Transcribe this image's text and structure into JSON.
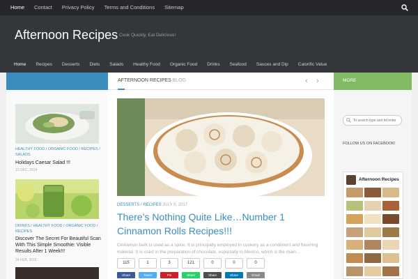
{
  "topbar": {
    "links": [
      "Home",
      "Contact",
      "Privacy Policy",
      "Terms and Conditions",
      "Sitemap"
    ],
    "active_index": 0
  },
  "header": {
    "site_title": "Afternoon Recipes",
    "tagline": "Cook Quickly, Eat Delicious!"
  },
  "mainnav": {
    "items": [
      "Home",
      "Recipes",
      "Desserts",
      "Diets",
      "Salads",
      "Healthy Food",
      "Organic Food",
      "Drinks",
      "Seafood",
      "Sauces and Dip",
      "Calorific Value"
    ],
    "active_index": 0
  },
  "blog": {
    "title_main": "AFTERNOON RECIPES",
    "title_suffix": "BLOG",
    "prev_arrow": "‹",
    "next_arrow": "›"
  },
  "right_head": {
    "label": "MORE"
  },
  "left_posts": [
    {
      "categories": "HEALTHY FOOD / ORGANIC FOOD / RECIPES / SALADS",
      "title": "Holidays Caesar Salad !!!",
      "date": "10 DEC, 2014"
    },
    {
      "categories": "DRINKS / HEALTHY FOOD / ORGANIC FOOD / RECIPES",
      "title": "Discover The Secret For Beautiful Scan With This Simple Smoothie: Visible Results After 1 Week!!!",
      "date": "24 FEB, 2015"
    }
  ],
  "featured": {
    "categories": "DESSERTS / RECIPES",
    "date": "JULY 9, 2017",
    "title": "There’s Nothing Quite Like…Number 1 Cinnamon Rolls Recipes!!!",
    "excerpt": "Cinnamon bark is used as a spice. It is principally employed in cookery as a condiment and flavoring material. It is used in the preparation of chocolate, especially in Mexico, which is the main…",
    "counts": [
      "115",
      "1",
      "3",
      "121",
      "0",
      "0",
      "0"
    ],
    "shares": [
      {
        "label": "Share",
        "color": "#3b5998"
      },
      {
        "label": "Tweet",
        "color": "#55acee"
      },
      {
        "label": "Pin",
        "color": "#cb2027"
      },
      {
        "label": "Share",
        "color": "#25d366"
      },
      {
        "label": "Share",
        "color": "#4d4d4d"
      },
      {
        "label": "Share",
        "color": "#0077b5"
      },
      {
        "label": "Email",
        "color": "#888888"
      }
    ]
  },
  "sidebar_right": {
    "search_placeholder": "To search type and hit enter",
    "follow_label": "FOLLOW US ON FACEBOOK!",
    "fb_page_name": "Afternoon Recipes"
  },
  "colors": {
    "accent_blue": "#3b8dbd",
    "accent_green": "#82b965",
    "topbar": "#26272b",
    "header": "#33363b"
  }
}
